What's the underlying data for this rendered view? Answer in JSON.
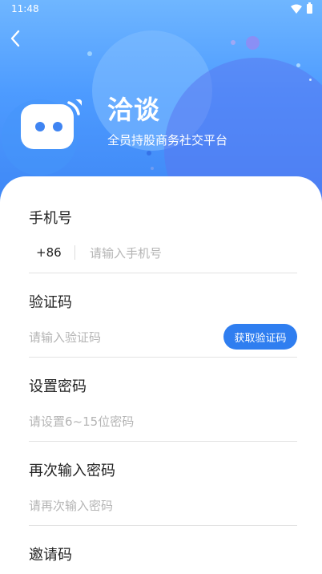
{
  "status_bar": {
    "time": "11:48"
  },
  "brand": {
    "name": "洽谈",
    "slogan": "全员持股商务社交平台"
  },
  "form": {
    "phone": {
      "label": "手机号",
      "country_code": "+86",
      "placeholder": "请输入手机号",
      "value": ""
    },
    "verify_code": {
      "label": "验证码",
      "placeholder": "请输入验证码",
      "value": "",
      "button_label": "获取验证码"
    },
    "password": {
      "label": "设置密码",
      "placeholder": "请设置6~15位密码",
      "value": ""
    },
    "confirm_password": {
      "label": "再次输入密码",
      "placeholder": "请再次输入密码",
      "value": ""
    },
    "invite_code": {
      "label": "邀请码"
    }
  },
  "colors": {
    "hero_top": "#6fb6ff",
    "hero_bottom": "#3e86f5",
    "accent_button": "#2f7ef0",
    "placeholder_text": "#b5b5b5"
  },
  "icons": [
    "back-arrow-icon",
    "wifi-icon",
    "battery-icon",
    "chat-robot-logo-icon"
  ]
}
